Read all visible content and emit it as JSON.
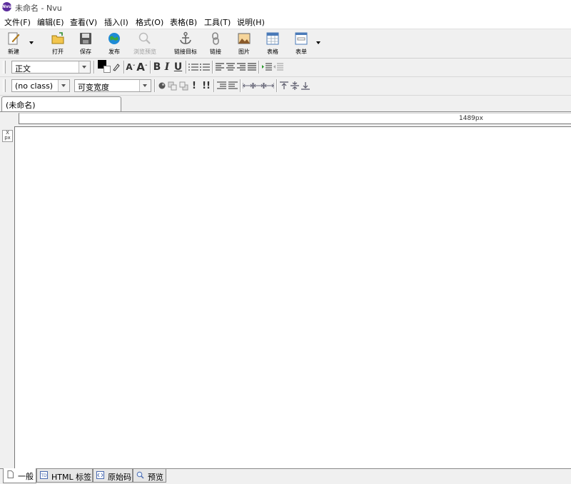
{
  "window": {
    "title": "未命名 - Nvu",
    "logo_text": "Nvu"
  },
  "menu": {
    "items": [
      "文件(F)",
      "编辑(E)",
      "查看(V)",
      "插入(I)",
      "格式(O)",
      "表格(B)",
      "工具(T)",
      "说明(H)"
    ]
  },
  "toolbar": {
    "new": "新建",
    "open": "打开",
    "save": "保存",
    "publish": "发布",
    "browse": "浏览预览",
    "anchor": "链接目标",
    "link": "链接",
    "image": "图片",
    "table": "表格",
    "form": "表单"
  },
  "format": {
    "paragraph_value": "正文",
    "class_value": "(no class)",
    "font_value": "可变宽度",
    "bold": "B",
    "italic": "I",
    "underline": "U",
    "important1": "!",
    "important2": "!!"
  },
  "tabs": {
    "document": "(未命名)"
  },
  "ruler": {
    "width_label": "1489px"
  },
  "vruler": {
    "label_top": "X",
    "label_bottom": "px"
  },
  "modes": {
    "normal": "一般",
    "html_tags": "HTML 标签",
    "source": "原始码",
    "preview": "预览"
  },
  "colors": {
    "logo": "#5b2c9c",
    "globe": "#1f8bd6",
    "text_color": "#000000"
  }
}
